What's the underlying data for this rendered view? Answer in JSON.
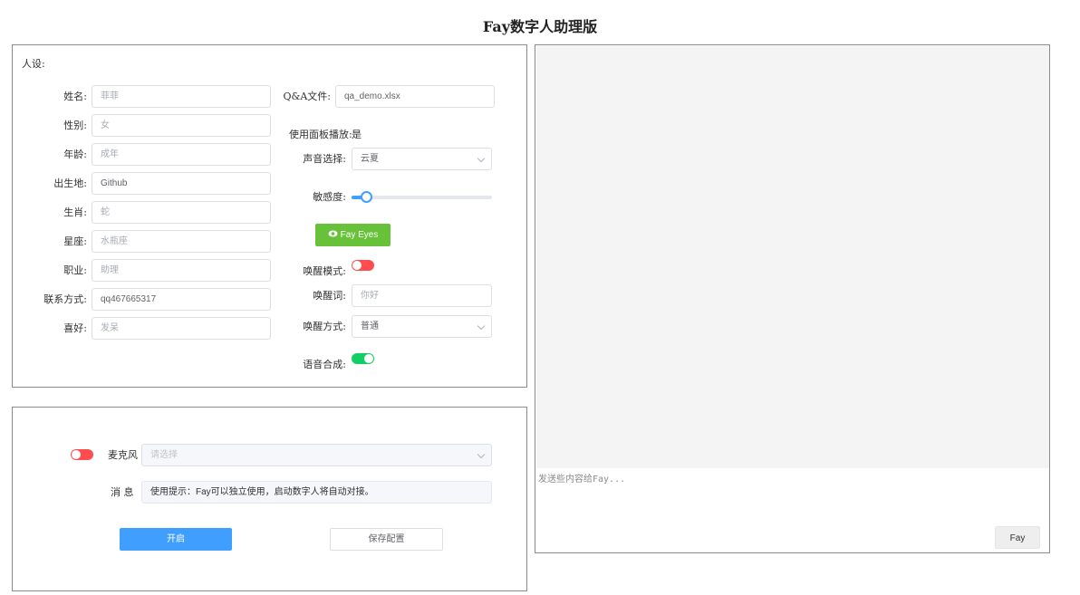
{
  "page_title": "Fay数字人助理版",
  "persona": {
    "header": "人设:",
    "fields": [
      {
        "label": "姓名:",
        "value": "菲菲"
      },
      {
        "label": "性别:",
        "value": "女"
      },
      {
        "label": "年龄:",
        "value": "成年"
      },
      {
        "label": "出生地:",
        "value": "Github"
      },
      {
        "label": "生肖:",
        "value": "蛇"
      },
      {
        "label": "星座:",
        "value": "水瓶座"
      },
      {
        "label": "职业:",
        "value": "助理"
      },
      {
        "label": "联系方式:",
        "value": "qq467665317"
      },
      {
        "label": "喜好:",
        "value": "发呆"
      }
    ],
    "qa_label": "Q&A文件:",
    "qa_value": "qa_demo.xlsx",
    "panel_play_label": "使用面板播放:",
    "panel_play_value": "是",
    "voice_label": "声音选择:",
    "voice_value": "云夏",
    "sensitivity_label": "敏感度:",
    "sensitivity_value": 0.1,
    "fay_eyes_label": "Fay Eyes",
    "wake_mode_label": "唤醒模式:",
    "wake_mode_on": false,
    "wake_word_label": "唤醒词:",
    "wake_word_placeholder": "你好",
    "wake_method_label": "唤醒方式:",
    "wake_method_value": "普通",
    "tts_label": "语音合成:",
    "tts_on": true
  },
  "control": {
    "mic_on": false,
    "mic_label": "麦克风",
    "mic_placeholder": "请选择",
    "message_label": "消 息",
    "message_text": "使用提示：Fay可以独立使用，启动数字人将自动对接。",
    "start_label": "开启",
    "save_label": "保存配置"
  },
  "chat": {
    "input_placeholder": "发送些内容给Fay...",
    "send_label": "Fay"
  },
  "colors": {
    "primary": "#409eff",
    "success": "#67c23a",
    "switch_off": "#ff4d4f",
    "switch_on": "#13ce66"
  }
}
